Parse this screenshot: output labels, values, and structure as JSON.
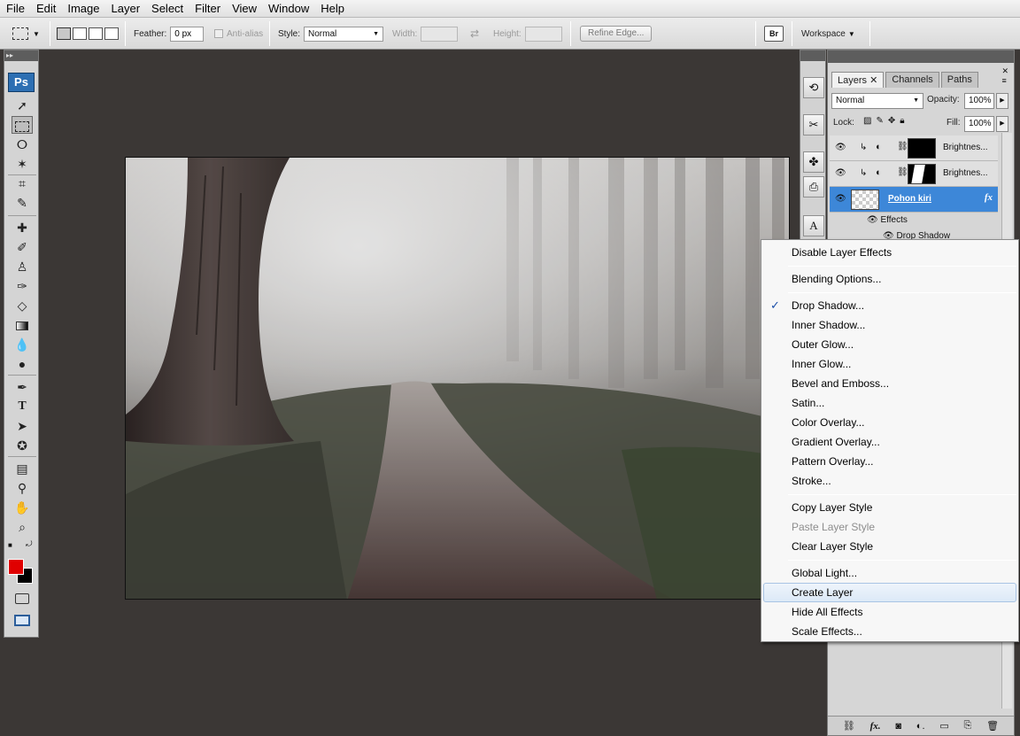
{
  "menubar": {
    "items": [
      "File",
      "Edit",
      "Image",
      "Layer",
      "Select",
      "Filter",
      "View",
      "Window",
      "Help"
    ]
  },
  "options": {
    "feather_label": "Feather:",
    "feather_value": "0 px",
    "antialias_label": "Anti-alias",
    "style_label": "Style:",
    "style_value": "Normal",
    "width_label": "Width:",
    "height_label": "Height:",
    "refine_edge": "Refine Edge...",
    "workspace": "Workspace"
  },
  "tools": {
    "logo": "Ps",
    "foreground_color": "#e00000",
    "background_color": "#000000"
  },
  "layers_panel": {
    "tabs": [
      "Layers",
      "Channels",
      "Paths"
    ],
    "blend_mode": "Normal",
    "opacity_label": "Opacity:",
    "opacity_value": "100%",
    "lock_label": "Lock:",
    "fill_label": "Fill:",
    "fill_value": "100%",
    "layers": [
      {
        "name": "Brightnes..."
      },
      {
        "name": "Brightnes..."
      },
      {
        "name": "Pohon kiri",
        "selected": true
      }
    ],
    "effects_label": "Effects",
    "effect_item": "Drop Shadow",
    "fx": "fx"
  },
  "context_menu": {
    "items": [
      {
        "label": "Disable Layer Effects"
      },
      {
        "label": "Blending Options..."
      },
      {
        "label": "Drop Shadow...",
        "checked": true
      },
      {
        "label": "Inner Shadow..."
      },
      {
        "label": "Outer Glow..."
      },
      {
        "label": "Inner Glow..."
      },
      {
        "label": "Bevel and Emboss..."
      },
      {
        "label": "Satin..."
      },
      {
        "label": "Color Overlay..."
      },
      {
        "label": "Gradient Overlay..."
      },
      {
        "label": "Pattern Overlay..."
      },
      {
        "label": "Stroke..."
      },
      {
        "label": "Copy Layer Style"
      },
      {
        "label": "Paste Layer Style",
        "disabled": true
      },
      {
        "label": "Clear Layer Style"
      },
      {
        "label": "Global Light..."
      },
      {
        "label": "Create Layer",
        "highlighted": true
      },
      {
        "label": "Hide All Effects"
      },
      {
        "label": "Scale Effects..."
      }
    ]
  },
  "colors": {
    "workspace_bg": "#3b3735",
    "selection_blue": "#3d87d8",
    "check_blue": "#1c4fa8"
  }
}
